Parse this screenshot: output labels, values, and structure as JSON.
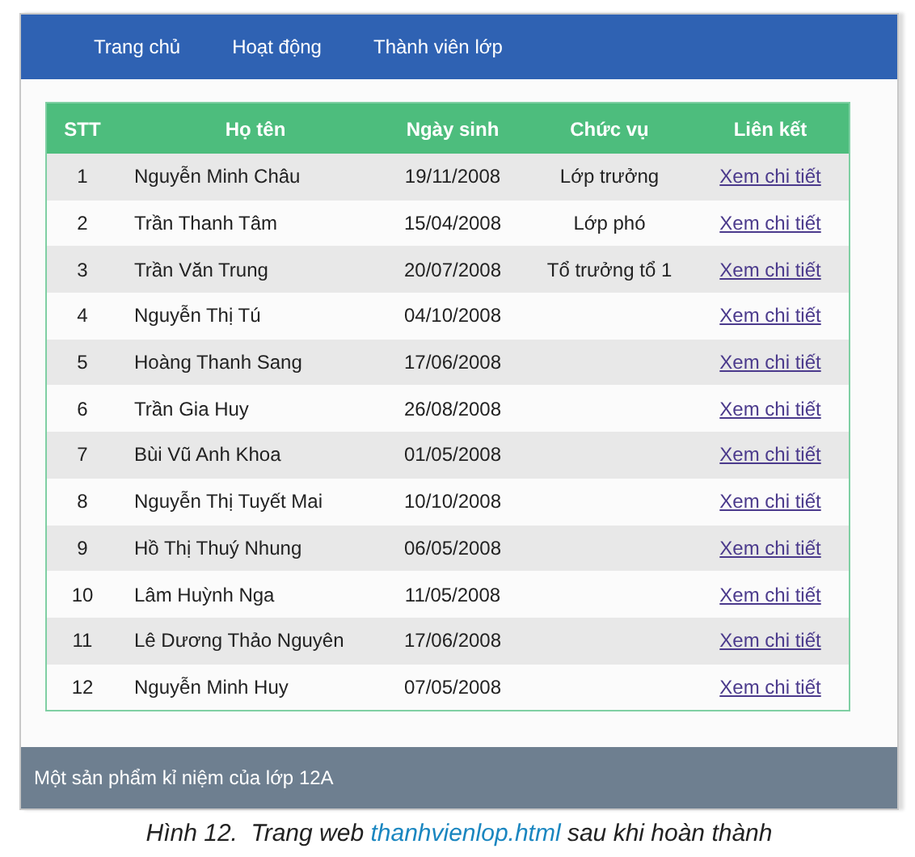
{
  "nav": {
    "items": [
      {
        "label": "Trang chủ"
      },
      {
        "label": "Hoạt động"
      },
      {
        "label": "Thành viên lớp"
      }
    ]
  },
  "table": {
    "columns": [
      "STT",
      "Họ tên",
      "Ngày sinh",
      "Chức vụ",
      "Liên kết"
    ],
    "rows": [
      {
        "no": "1",
        "name": "Nguyễn Minh Châu",
        "birth": "19/11/2008",
        "role": "Lớp trưởng",
        "link": "Xem chi tiết"
      },
      {
        "no": "2",
        "name": "Trần Thanh Tâm",
        "birth": "15/04/2008",
        "role": "Lớp phó",
        "link": "Xem chi tiết"
      },
      {
        "no": "3",
        "name": "Trần Văn Trung",
        "birth": "20/07/2008",
        "role": "Tổ trưởng tổ 1",
        "link": "Xem chi tiết"
      },
      {
        "no": "4",
        "name": "Nguyễn Thị Tú",
        "birth": "04/10/2008",
        "link": "Xem chi tiết"
      },
      {
        "no": "5",
        "name": "Hoàng Thanh Sang",
        "birth": "17/06/2008",
        "link": "Xem chi tiết"
      },
      {
        "no": "6",
        "name": "Trần Gia Huy",
        "birth": "26/08/2008",
        "link": "Xem chi tiết"
      },
      {
        "no": "7",
        "name": "Bùi Vũ Anh Khoa",
        "birth": "01/05/2008",
        "link": "Xem chi tiết"
      },
      {
        "no": "8",
        "name": "Nguyễn Thị Tuyết Mai",
        "birth": "10/10/2008",
        "link": "Xem chi tiết"
      },
      {
        "no": "9",
        "name": "Hồ Thị Thuý Nhung",
        "birth": "06/05/2008",
        "link": "Xem chi tiết"
      },
      {
        "no": "10",
        "name": "Lâm Huỳnh Nga",
        "birth": "11/05/2008",
        "link": "Xem chi tiết"
      },
      {
        "no": "11",
        "name": "Lê Dương Thảo Nguyên",
        "birth": "17/06/2008",
        "link": "Xem chi tiết"
      },
      {
        "no": "12",
        "name": "Nguyễn Minh Huy",
        "birth": "07/05/2008",
        "link": "Xem chi tiết"
      }
    ]
  },
  "footer": {
    "text": "Một sản phẩm kỉ niệm của lớp 12A"
  },
  "caption": {
    "number": "Hình 12.",
    "before": "Trang web",
    "highlight": "thanhvienlop.html",
    "after": "sau khi hoàn thành"
  }
}
